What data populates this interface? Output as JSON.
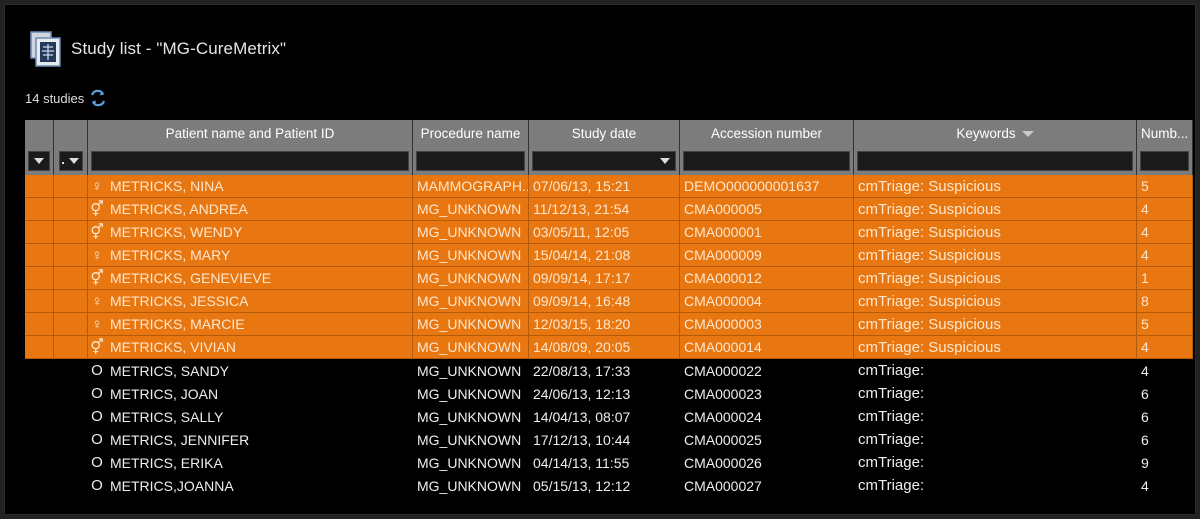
{
  "window": {
    "title": "Study list - \"MG-CureMetrix\"",
    "study_count": "14 studies",
    "icons": {
      "app": "document-xray-icon",
      "refresh": "refresh-icon"
    }
  },
  "table": {
    "columns": [
      {
        "label": ""
      },
      {
        "label": ""
      },
      {
        "label": "Patient name and Patient ID"
      },
      {
        "label": "Procedure name"
      },
      {
        "label": "Study date"
      },
      {
        "label": "Accession number"
      },
      {
        "label": "Keywords"
      },
      {
        "label": "Numb..."
      }
    ],
    "filters": {
      "patient": "",
      "procedure": "",
      "date": "",
      "accession": "",
      "keywords": "",
      "number": ""
    },
    "rows": [
      {
        "sym": "♀",
        "name": "METRICKS, NINA",
        "procedure": "MAMMOGRAPH...",
        "date": "07/06/13, 15:21",
        "accession": "DEMO000000001637",
        "keywords": "cmTriage: Suspicious",
        "number": "5",
        "highlight": true
      },
      {
        "sym": "⚥",
        "name": "METRICKS, ANDREA",
        "procedure": "MG_UNKNOWN",
        "date": "11/12/13, 21:54",
        "accession": "CMA000005",
        "keywords": "cmTriage: Suspicious",
        "number": "4",
        "highlight": true
      },
      {
        "sym": "⚥",
        "name": "METRICKS, WENDY",
        "procedure": "MG_UNKNOWN",
        "date": "03/05/11, 12:05",
        "accession": "CMA000001",
        "keywords": "cmTriage: Suspicious",
        "number": "4",
        "highlight": true
      },
      {
        "sym": "♀",
        "name": "METRICKS, MARY",
        "procedure": "MG_UNKNOWN",
        "date": "15/04/14, 21:08",
        "accession": "CMA000009",
        "keywords": "cmTriage: Suspicious",
        "number": "4",
        "highlight": true
      },
      {
        "sym": "⚥",
        "name": "METRICKS, GENEVIEVE",
        "procedure": "MG_UNKNOWN",
        "date": "09/09/14, 17:17",
        "accession": "CMA000012",
        "keywords": "cmTriage: Suspicious",
        "number": "1",
        "highlight": true
      },
      {
        "sym": "♀",
        "name": "METRICKS, JESSICA",
        "procedure": "MG_UNKNOWN",
        "date": "09/09/14, 16:48",
        "accession": "CMA000004",
        "keywords": "cmTriage: Suspicious",
        "number": "8",
        "highlight": true
      },
      {
        "sym": "♀",
        "name": "METRICKS, MARCIE",
        "procedure": "MG_UNKNOWN",
        "date": "12/03/15, 18:20",
        "accession": "CMA000003",
        "keywords": "cmTriage: Suspicious",
        "number": "5",
        "highlight": true
      },
      {
        "sym": "⚥",
        "name": "METRICKS, VIVIAN",
        "procedure": "MG_UNKNOWN",
        "date": "14/08/09, 20:05",
        "accession": "CMA000014",
        "keywords": "cmTriage: Suspicious",
        "number": "4",
        "highlight": true
      },
      {
        "sym": "O",
        "name": "METRICS, SANDY",
        "procedure": "MG_UNKNOWN",
        "date": "22/08/13, 17:33",
        "accession": "CMA000022",
        "keywords": "cmTriage:",
        "number": "4",
        "highlight": false
      },
      {
        "sym": "O",
        "name": "METRICS, JOAN",
        "procedure": "MG_UNKNOWN",
        "date": "24/06/13, 12:13",
        "accession": "CMA000023",
        "keywords": "cmTriage:",
        "number": "6",
        "highlight": false
      },
      {
        "sym": "O",
        "name": "METRICS, SALLY",
        "procedure": "MG_UNKNOWN",
        "date": "14/04/13, 08:07",
        "accession": "CMA000024",
        "keywords": "cmTriage:",
        "number": "6",
        "highlight": false
      },
      {
        "sym": "O",
        "name": "METRICS, JENNIFER",
        "procedure": "MG_UNKNOWN",
        "date": "17/12/13, 10:44",
        "accession": "CMA000025",
        "keywords": "cmTriage:",
        "number": "6",
        "highlight": false
      },
      {
        "sym": "O",
        "name": "METRICS, ERIKA",
        "procedure": "MG_UNKNOWN",
        "date": "04/14/13, 11:55",
        "accession": "CMA000026",
        "keywords": "cmTriage:",
        "number": "9",
        "highlight": false
      },
      {
        "sym": "O",
        "name": "METRICS,JOANNA",
        "procedure": "MG_UNKNOWN",
        "date": "05/15/13, 12:12",
        "accession": "CMA000027",
        "keywords": "cmTriage:",
        "number": "4",
        "highlight": false
      }
    ]
  },
  "colors": {
    "highlight_row": "#e87712",
    "header_bg": "#7c7c7c",
    "window_bg": "#000000"
  }
}
